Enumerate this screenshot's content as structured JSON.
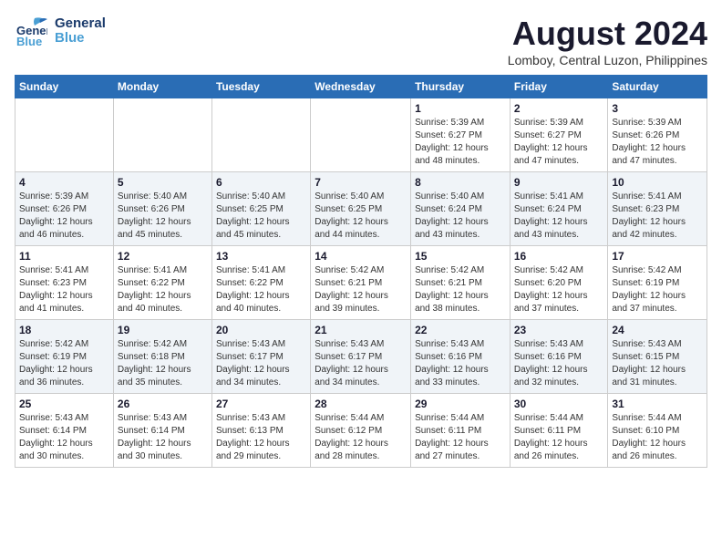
{
  "header": {
    "logo_general": "General",
    "logo_blue": "Blue",
    "month_year": "August 2024",
    "location": "Lomboy, Central Luzon, Philippines"
  },
  "days_of_week": [
    "Sunday",
    "Monday",
    "Tuesday",
    "Wednesday",
    "Thursday",
    "Friday",
    "Saturday"
  ],
  "weeks": [
    [
      {
        "day": "",
        "info": ""
      },
      {
        "day": "",
        "info": ""
      },
      {
        "day": "",
        "info": ""
      },
      {
        "day": "",
        "info": ""
      },
      {
        "day": "1",
        "info": "Sunrise: 5:39 AM\nSunset: 6:27 PM\nDaylight: 12 hours\nand 48 minutes."
      },
      {
        "day": "2",
        "info": "Sunrise: 5:39 AM\nSunset: 6:27 PM\nDaylight: 12 hours\nand 47 minutes."
      },
      {
        "day": "3",
        "info": "Sunrise: 5:39 AM\nSunset: 6:26 PM\nDaylight: 12 hours\nand 47 minutes."
      }
    ],
    [
      {
        "day": "4",
        "info": "Sunrise: 5:39 AM\nSunset: 6:26 PM\nDaylight: 12 hours\nand 46 minutes."
      },
      {
        "day": "5",
        "info": "Sunrise: 5:40 AM\nSunset: 6:26 PM\nDaylight: 12 hours\nand 45 minutes."
      },
      {
        "day": "6",
        "info": "Sunrise: 5:40 AM\nSunset: 6:25 PM\nDaylight: 12 hours\nand 45 minutes."
      },
      {
        "day": "7",
        "info": "Sunrise: 5:40 AM\nSunset: 6:25 PM\nDaylight: 12 hours\nand 44 minutes."
      },
      {
        "day": "8",
        "info": "Sunrise: 5:40 AM\nSunset: 6:24 PM\nDaylight: 12 hours\nand 43 minutes."
      },
      {
        "day": "9",
        "info": "Sunrise: 5:41 AM\nSunset: 6:24 PM\nDaylight: 12 hours\nand 43 minutes."
      },
      {
        "day": "10",
        "info": "Sunrise: 5:41 AM\nSunset: 6:23 PM\nDaylight: 12 hours\nand 42 minutes."
      }
    ],
    [
      {
        "day": "11",
        "info": "Sunrise: 5:41 AM\nSunset: 6:23 PM\nDaylight: 12 hours\nand 41 minutes."
      },
      {
        "day": "12",
        "info": "Sunrise: 5:41 AM\nSunset: 6:22 PM\nDaylight: 12 hours\nand 40 minutes."
      },
      {
        "day": "13",
        "info": "Sunrise: 5:41 AM\nSunset: 6:22 PM\nDaylight: 12 hours\nand 40 minutes."
      },
      {
        "day": "14",
        "info": "Sunrise: 5:42 AM\nSunset: 6:21 PM\nDaylight: 12 hours\nand 39 minutes."
      },
      {
        "day": "15",
        "info": "Sunrise: 5:42 AM\nSunset: 6:21 PM\nDaylight: 12 hours\nand 38 minutes."
      },
      {
        "day": "16",
        "info": "Sunrise: 5:42 AM\nSunset: 6:20 PM\nDaylight: 12 hours\nand 37 minutes."
      },
      {
        "day": "17",
        "info": "Sunrise: 5:42 AM\nSunset: 6:19 PM\nDaylight: 12 hours\nand 37 minutes."
      }
    ],
    [
      {
        "day": "18",
        "info": "Sunrise: 5:42 AM\nSunset: 6:19 PM\nDaylight: 12 hours\nand 36 minutes."
      },
      {
        "day": "19",
        "info": "Sunrise: 5:42 AM\nSunset: 6:18 PM\nDaylight: 12 hours\nand 35 minutes."
      },
      {
        "day": "20",
        "info": "Sunrise: 5:43 AM\nSunset: 6:17 PM\nDaylight: 12 hours\nand 34 minutes."
      },
      {
        "day": "21",
        "info": "Sunrise: 5:43 AM\nSunset: 6:17 PM\nDaylight: 12 hours\nand 34 minutes."
      },
      {
        "day": "22",
        "info": "Sunrise: 5:43 AM\nSunset: 6:16 PM\nDaylight: 12 hours\nand 33 minutes."
      },
      {
        "day": "23",
        "info": "Sunrise: 5:43 AM\nSunset: 6:16 PM\nDaylight: 12 hours\nand 32 minutes."
      },
      {
        "day": "24",
        "info": "Sunrise: 5:43 AM\nSunset: 6:15 PM\nDaylight: 12 hours\nand 31 minutes."
      }
    ],
    [
      {
        "day": "25",
        "info": "Sunrise: 5:43 AM\nSunset: 6:14 PM\nDaylight: 12 hours\nand 30 minutes."
      },
      {
        "day": "26",
        "info": "Sunrise: 5:43 AM\nSunset: 6:14 PM\nDaylight: 12 hours\nand 30 minutes."
      },
      {
        "day": "27",
        "info": "Sunrise: 5:43 AM\nSunset: 6:13 PM\nDaylight: 12 hours\nand 29 minutes."
      },
      {
        "day": "28",
        "info": "Sunrise: 5:44 AM\nSunset: 6:12 PM\nDaylight: 12 hours\nand 28 minutes."
      },
      {
        "day": "29",
        "info": "Sunrise: 5:44 AM\nSunset: 6:11 PM\nDaylight: 12 hours\nand 27 minutes."
      },
      {
        "day": "30",
        "info": "Sunrise: 5:44 AM\nSunset: 6:11 PM\nDaylight: 12 hours\nand 26 minutes."
      },
      {
        "day": "31",
        "info": "Sunrise: 5:44 AM\nSunset: 6:10 PM\nDaylight: 12 hours\nand 26 minutes."
      }
    ]
  ]
}
